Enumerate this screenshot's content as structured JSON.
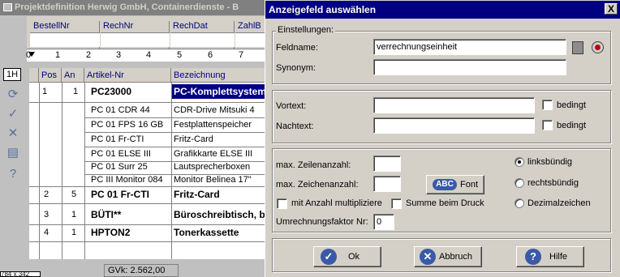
{
  "background_window": {
    "title": "Projektdefinition  Herwig GmbH, Containerdienste - B",
    "header_columns": [
      "BestellNr",
      "RechNr",
      "RechDat",
      "ZahlB"
    ],
    "ruler_numbers": [
      "0",
      "1",
      "2",
      "3",
      "4",
      "5",
      "6",
      "7"
    ],
    "toolbar_field": "1H",
    "grid_columns": [
      "Pos",
      "An",
      "Artikel-Nr",
      "Bezeichnung"
    ],
    "rows": [
      {
        "pos": "1",
        "an": "1",
        "artikel": "PC23000",
        "bez": "PC-Komplettsystem",
        "bold": true
      },
      {
        "pos": "",
        "an": "",
        "artikel": "PC 01 CDR 44",
        "bez": "CDR-Drive Mitsuki 4",
        "bold": false
      },
      {
        "pos": "",
        "an": "",
        "artikel": "PC 01 FPS 16 GB",
        "bez": "Festplattenspeicher",
        "bold": false
      },
      {
        "pos": "",
        "an": "",
        "artikel": "PC 01 Fr-CTI",
        "bez": "Fritz-Card",
        "bold": false
      },
      {
        "pos": "",
        "an": "",
        "artikel": "PC 01 ELSE III",
        "bez": "Grafikkarte ELSE III",
        "bold": false
      },
      {
        "pos": "",
        "an": "",
        "artikel": "PC 01 Surr 25",
        "bez": "Lautsprecherboxen",
        "bold": false
      },
      {
        "pos": "",
        "an": "",
        "artikel": "PC III Monitor 084",
        "bez": "Monitor Belinea 17\"",
        "bold": false
      },
      {
        "pos": "2",
        "an": "5",
        "artikel": "PC 01 Fr-CTI",
        "bez": "Fritz-Card",
        "bold": true
      },
      {
        "pos": "3",
        "an": "1",
        "artikel": "BÜTI**",
        "bez": "Büroschreibtisch, b",
        "bold": true
      },
      {
        "pos": "4",
        "an": "1",
        "artikel": "HPTON2",
        "bez": "Tonerkassette",
        "bold": true
      }
    ],
    "status_gvk": "GVk: 2.562,00",
    "status_cut": "784 x 342"
  },
  "dialog": {
    "title": "Anzeigefeld auswählen",
    "close_label": "X",
    "group_einstellungen": "Einstellungen:",
    "feldname_label": "Feldname:",
    "feldname_value": "verrechnungseinheit",
    "synonym_label": "Synonym:",
    "synonym_value": "",
    "vortext_label": "Vortext:",
    "vortext_value": "",
    "nachtext_label": "Nachtext:",
    "nachtext_value": "",
    "bedingt_label": "bedingt",
    "max_zeilen_label": "max. Zeilenanzahl:",
    "max_zeilen_value": "",
    "max_zeichen_label": "max. Zeichenanzahl:",
    "max_zeichen_value": "",
    "font_badge": "ABC",
    "font_label": "Font",
    "radio_links": "linksbündig",
    "radio_rechts": "rechtsbündig",
    "radio_dezimal": "Dezimalzeichen",
    "mit_anzahl_label": "mit Anzahl multipliziere",
    "summe_label": "Summe beim Druck",
    "umrechnung_label": "Umrechnungsfaktor Nr:",
    "umrechnung_value": "0",
    "ok_label": "Ok",
    "abbruch_label": "Abbruch",
    "hilfe_label": "Hilfe"
  }
}
